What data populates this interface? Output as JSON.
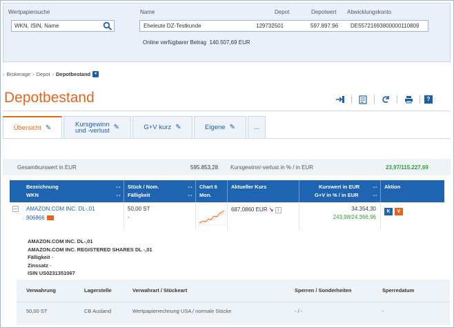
{
  "search": {
    "label": "Wertpapiersuche",
    "placeholder": "WKN, ISIN, Name",
    "value": "WKN, ISIN, Name"
  },
  "account": {
    "name_label": "Name",
    "depot_label": "Depot",
    "depotwert_label": "Depotwert",
    "konto_label": "Abwicklungskonto",
    "name": "Eheleute DZ-Testkunde",
    "depot": "129732501",
    "depotwert": "597.897,96",
    "konto": "DE55721693800000110809",
    "available_label": "Online verfügbarer Betrag",
    "available_value": "140.507,69 EUR"
  },
  "breadcrumb": [
    "Brokerage",
    "Depot",
    "Depotbestand"
  ],
  "page_title": "Depotbestand",
  "tabs": [
    {
      "line1": "Übersicht",
      "line2": ""
    },
    {
      "line1": "Kursgewinn",
      "line2": "und -verlust"
    },
    {
      "line1": "G+V kurz",
      "line2": ""
    },
    {
      "line1": "Eigene",
      "line2": ""
    },
    {
      "line1": "...",
      "line2": ""
    }
  ],
  "totals": {
    "label": "Gesamtkurswert in EUR",
    "value": "595.853,28",
    "gv_label": "Kursgewinn/-verlust in % / in EUR",
    "gv_value": "23,97/115.227,69"
  },
  "table": {
    "headers": {
      "bez1": "Bezeichnung",
      "bez2": "WKN",
      "stk1": "Stück / Nom.",
      "stk2": "Fälligkeit",
      "chart1": "Chart 6",
      "chart2": "Mon.",
      "kurs": "Aktueller Kurs",
      "kw1": "Kurswert in EUR",
      "kw2": "G+V in % / in EUR",
      "aktion": "Aktion",
      "sort": "- -"
    },
    "row": {
      "name": "AMAZON.COM INC. DL-,01",
      "wkn": "906866",
      "stueck": "50,00 ST",
      "faelligkeit": "-",
      "kurs": "687,0860 EUR",
      "kurswert": "34.354,30",
      "gv": "243,98/24.366,96",
      "action_k": "K",
      "action_v": "V",
      "info": "i"
    }
  },
  "details": {
    "line1": "AMAZON.COM INC. DL-,01",
    "line2": "AMAZON.COM INC. REGISTERED SHARES DL -,01",
    "faelligkeit_label": "Fälligkeit",
    "faelligkeit_value": "-",
    "zinssatz_label": "Zinssatz",
    "zinssatz_value": "-",
    "isin_label": "ISIN",
    "isin_value": "US0231351067"
  },
  "custody": {
    "h_verwahrung": "Verwahrung",
    "h_lagerstelle": "Lagerstelle",
    "h_verwahrart": "Verwahrart / Stückeart",
    "h_sperren": "Sperren / Sonderheiten",
    "h_sperrdatum": "Sperredatum",
    "v_verwahrung": "50,00 ST",
    "v_lagerstelle": "CB Ausland",
    "v_verwahrart": "Wertpapierrechnung USA / normale Stücke",
    "v_sperren": "- / -",
    "v_sperrdatum": "-"
  },
  "colors": {
    "accent": "#e3651d",
    "header_blue": "#1f64b0",
    "link_blue": "#1f5fa6",
    "positive_green": "#2e9e2e"
  }
}
